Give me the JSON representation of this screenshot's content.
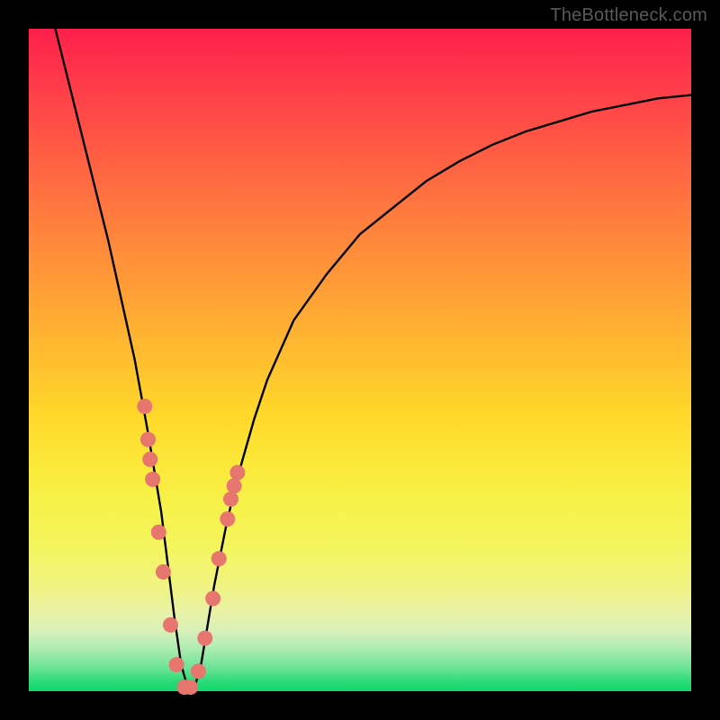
{
  "watermark": "TheBottleneck.com",
  "chart_data": {
    "type": "line",
    "title": "",
    "xlabel": "",
    "ylabel": "",
    "xlim": [
      0,
      100
    ],
    "ylim": [
      0,
      100
    ],
    "series": [
      {
        "name": "bottleneck-curve",
        "x": [
          4,
          6,
          8,
          10,
          12,
          14,
          16,
          18,
          19,
          20,
          21,
          22,
          23,
          24,
          25,
          26,
          27,
          28,
          30,
          32,
          34,
          36,
          40,
          45,
          50,
          55,
          60,
          65,
          70,
          75,
          80,
          85,
          90,
          95,
          100
        ],
        "values": [
          100,
          92,
          84,
          76,
          68,
          59,
          50,
          39,
          33,
          27,
          19,
          11,
          4,
          0.5,
          0.5,
          4,
          10,
          16,
          26,
          34,
          41,
          47,
          56,
          63,
          69,
          73,
          77,
          80,
          82.5,
          84.5,
          86,
          87.5,
          88.5,
          89.5,
          90
        ]
      }
    ],
    "markers": {
      "name": "highlighted-points",
      "color": "#e7766f",
      "points": [
        {
          "x": 17.5,
          "y": 43
        },
        {
          "x": 18.0,
          "y": 38
        },
        {
          "x": 18.3,
          "y": 35
        },
        {
          "x": 18.7,
          "y": 32
        },
        {
          "x": 19.6,
          "y": 24
        },
        {
          "x": 20.3,
          "y": 18
        },
        {
          "x": 21.4,
          "y": 10
        },
        {
          "x": 22.3,
          "y": 4
        },
        {
          "x": 23.5,
          "y": 0.6
        },
        {
          "x": 24.4,
          "y": 0.6
        },
        {
          "x": 25.6,
          "y": 3
        },
        {
          "x": 26.6,
          "y": 8
        },
        {
          "x": 27.8,
          "y": 14
        },
        {
          "x": 28.7,
          "y": 20
        },
        {
          "x": 30.0,
          "y": 26
        },
        {
          "x": 30.5,
          "y": 29
        },
        {
          "x": 31.0,
          "y": 31
        },
        {
          "x": 31.5,
          "y": 33
        }
      ]
    }
  }
}
